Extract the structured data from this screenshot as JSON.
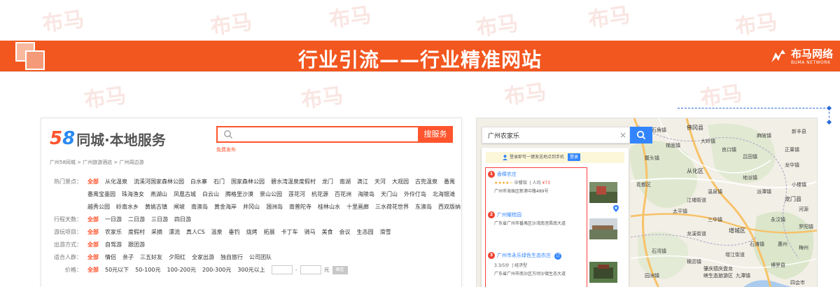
{
  "banner": {
    "title": "行业引流——行业精准网站",
    "brand_cn": "布马网络",
    "brand_en": "BUMA NETWORK"
  },
  "watermark": "布马",
  "site58": {
    "logo_num_5": "5",
    "logo_num_8": "8",
    "logo_text": "同城·本地服务",
    "search_placeholder": "",
    "search_button": "搜服务",
    "free_publish": "免费发布",
    "breadcrumb": "广州58同城 > 广州旅游酒店 > 广州周边游",
    "filters": [
      {
        "label": "热门景点：",
        "options": [
          "全部",
          "从化温泉",
          "流溪河国家森林公园",
          "白水寨",
          "石门",
          "国家森林公园",
          "碧水湾温泉度假村",
          "龙门",
          "南湖",
          "滴江",
          "天河",
          "大观园",
          "古兜温泉",
          "番禺"
        ]
      },
      {
        "label": "",
        "options": [
          "番禺宝墨园",
          "珠海渔女",
          "燕湖山",
          "凤凰古城",
          "白云山",
          "腾格里沙漠",
          "景山公园",
          "莲花河",
          "杭花源",
          "百花洲",
          "海陵岛",
          "天门山",
          "外伶仃岛",
          "北海银滩"
        ]
      },
      {
        "label": "",
        "options": [
          "越秀公园",
          "岭南水乡",
          "黄姚古镇",
          "闸坡",
          "南澳岛",
          "黄金海岸",
          "井冈山",
          "涠洲岛",
          "南普陀寺",
          "桂林山水",
          "十里画廊",
          "三水荷花世界",
          "东澳岛",
          "西双版纳"
        ]
      },
      {
        "label": "行程天数：",
        "options": [
          "全部",
          "一日游",
          "二日游",
          "三日游",
          "四日游"
        ]
      },
      {
        "label": "游玩项目：",
        "options": [
          "全部",
          "农家乐",
          "度假村",
          "采摘",
          "漂流",
          "真人CS",
          "温泉",
          "垂钓",
          "烧烤",
          "拓展",
          "卡丁车",
          "骑马",
          "美食",
          "会议",
          "生态园",
          "滑雪"
        ]
      },
      {
        "label": "出游方式：",
        "options": [
          "全部",
          "自驾游",
          "跟团游"
        ]
      },
      {
        "label": "适合人群：",
        "options": [
          "全部",
          "情侣",
          "亲子",
          "三五好友",
          "夕阳红",
          "全家出游",
          "独自旅行",
          "公司团队"
        ]
      },
      {
        "label": "价格：",
        "options": [
          "全部",
          "50元以下",
          "50-100元",
          "100-200元",
          "200-300元",
          "300元以上"
        ]
      }
    ],
    "price_unit": "元",
    "price_ok": "确定"
  },
  "map": {
    "search_value": "广州农家乐",
    "clear_symbol": "×",
    "login_text": "登录即可一键发送地点到手机",
    "login_button": "登录",
    "results": [
      {
        "index": "1",
        "name": "香樟农庄",
        "stars": "★★★★☆",
        "category": "中餐馆",
        "per_person": "人均",
        "price": "¥73",
        "address": "广州市海珠区新港中路489号"
      },
      {
        "index": "2",
        "name": "广州耀桂园",
        "address": "广东省广州市番禺区沙湾南滘昌南大道"
      },
      {
        "index": "3",
        "name": "广州市永乐绿色生态农庄",
        "verified": "订",
        "rating": "3.3/5分",
        "type": "经济型",
        "address": "广东省广州市南沙区万顷沙镇生态大道"
      }
    ],
    "labels": [
      {
        "text": "花都区"
      },
      {
        "text": "从化区"
      },
      {
        "text": "太平镇"
      },
      {
        "text": "鳌头镇"
      },
      {
        "text": "大岭镇"
      },
      {
        "text": "增城区"
      },
      {
        "text": "佛冈县"
      },
      {
        "text": "龙门县"
      },
      {
        "text": "石角镇"
      },
      {
        "text": "吕田镇"
      },
      {
        "text": "梯面镇"
      },
      {
        "text": "良口镇"
      },
      {
        "text": "温泉镇"
      },
      {
        "text": "派潭镇"
      },
      {
        "text": "江埔街道"
      },
      {
        "text": "龙华镇"
      },
      {
        "text": "永汉镇"
      },
      {
        "text": "地派镇"
      },
      {
        "text": "正果镇"
      },
      {
        "text": "小楼镇"
      },
      {
        "text": "新丰县"
      },
      {
        "text": "三华镇"
      },
      {
        "text": "石滩镇"
      },
      {
        "text": "增江街道"
      },
      {
        "text": "惠州"
      },
      {
        "text": "梅州"
      },
      {
        "text": "河源"
      },
      {
        "text": "横沥镇"
      },
      {
        "text": "博罗县"
      },
      {
        "text": "罗阳镇"
      },
      {
        "text": "石湾镇"
      },
      {
        "text": "园洲镇"
      },
      {
        "text": "麻陂镇"
      },
      {
        "text": "九潭镇"
      },
      {
        "text": "龙溪街道"
      }
    ],
    "park_label_line1": "肇庆德庆盘龙",
    "park_label_line2": "峡生态旅游区",
    "bottom_label": "四会市"
  }
}
